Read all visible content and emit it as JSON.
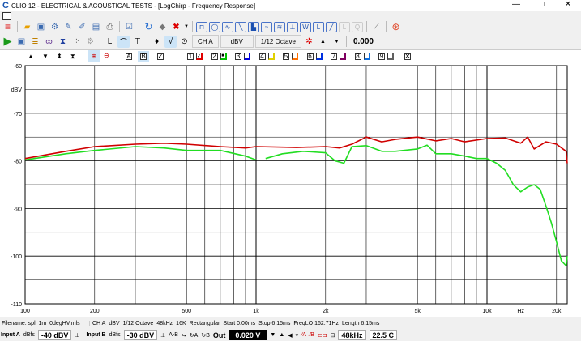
{
  "window": {
    "logo": "C",
    "title": "CLIO 12 - ELECTRICAL & ACOUSTICAL TESTS - [LogChirp - Frequency Response]",
    "min": "—",
    "max": "□",
    "close": "✕"
  },
  "toolbar2": {
    "channel": "CH A",
    "unit": "dBV",
    "smoothing": "1/12 Octave",
    "value": "0.000"
  },
  "chart_toolbar": {
    "a": "A",
    "b": "B",
    "curves": [
      "1",
      "2",
      "3",
      "4",
      "5",
      "6",
      "7",
      "8",
      "9"
    ],
    "colors": [
      "#e00000",
      "#00c000",
      "#0000e0",
      "#e0d000",
      "#ff7000",
      "#0030e0",
      "#800060",
      "#1070e0",
      "#606060"
    ],
    "close": "✕"
  },
  "chart_data": {
    "type": "line",
    "ylabel": "dBV",
    "xlabel": "Hz",
    "xscale": "log",
    "xlim": [
      100,
      24000
    ],
    "ylim": [
      -110,
      -60
    ],
    "yticks": [
      "-60",
      "-70",
      "-80",
      "-90",
      "-100",
      "-110"
    ],
    "ytick_values": [
      -60,
      -70,
      -80,
      -90,
      -100,
      -110
    ],
    "xticks": [
      {
        "v": 100,
        "l": "100"
      },
      {
        "v": 200,
        "l": "200"
      },
      {
        "v": 500,
        "l": "500"
      },
      {
        "v": 1000,
        "l": "1k"
      },
      {
        "v": 2000,
        "l": "2k"
      },
      {
        "v": 5000,
        "l": "5k"
      },
      {
        "v": 10000,
        "l": "10k"
      },
      {
        "v": 20000,
        "l": "20k"
      }
    ],
    "series": [
      {
        "name": "curve 1",
        "color": "#d00000",
        "x": [
          100,
          150,
          200,
          300,
          400,
          500,
          700,
          900,
          1000,
          1500,
          2000,
          2300,
          2600,
          3000,
          3500,
          4000,
          5000,
          6000,
          7000,
          8000,
          10000,
          12000,
          14000,
          15000,
          16000,
          18000,
          20000,
          22000,
          24000
        ],
        "y": [
          -79.5,
          -78,
          -77,
          -76.5,
          -76.3,
          -76.5,
          -77,
          -77.3,
          -77,
          -77.2,
          -77,
          -77.3,
          -76.5,
          -75,
          -76,
          -75.5,
          -75,
          -75.8,
          -75.3,
          -76,
          -75.3,
          -75.2,
          -76.3,
          -75,
          -77.5,
          -76,
          -76.5,
          -78,
          -80.5
        ]
      },
      {
        "name": "curve 2",
        "color": "#22dd22",
        "x": [
          100,
          150,
          200,
          300,
          400,
          500,
          700,
          900,
          1000,
          null,
          1100,
          1300,
          1600,
          2000,
          2200,
          2400,
          2600,
          3000,
          3500,
          4000,
          5000,
          5500,
          6000,
          7000,
          8000,
          9000,
          10000,
          11000,
          12000,
          13000,
          14000,
          15000,
          16000,
          17000,
          18000,
          19000,
          20000,
          21000,
          22000,
          24000
        ],
        "y": [
          -79.8,
          -78.5,
          -77.8,
          -77,
          -77.3,
          -77.8,
          -77.8,
          -79,
          -79.8,
          null,
          -79.5,
          -78.5,
          -78,
          -78.3,
          -80,
          -80.5,
          -77,
          -76.8,
          -78,
          -78,
          -77.5,
          -76.7,
          -78.5,
          -78.5,
          -79,
          -79.5,
          -79.5,
          -80.5,
          -82,
          -85,
          -86.5,
          -85.5,
          -85,
          -86,
          -89.5,
          -93,
          -97,
          -101,
          -102,
          -100
        ]
      }
    ]
  },
  "status": {
    "filename": "Filename: spl_1m_0degHV.mls",
    "channel": "CH A",
    "unit": "dBV",
    "smoothing": "1/12 Octave",
    "rate": "48kHz",
    "size": "16K",
    "window": "Rectangular",
    "start": "Start 0.00ms",
    "stop": "Stop 6.15ms",
    "freqlo": "FreqLO 162.71Hz",
    "length": "Length 6.15ms"
  },
  "bottom": {
    "input_a": "Input A",
    "dbfs_a": "dBfs",
    "level_a": "-40 dBV",
    "input_b": "Input B",
    "dbfs_b": "dBfs",
    "level_b": "-30 dBV",
    "ab": "A-B",
    "out": "Out",
    "out_value": "0.020 V",
    "rate": "48kHz",
    "temp": "22.5 C"
  }
}
